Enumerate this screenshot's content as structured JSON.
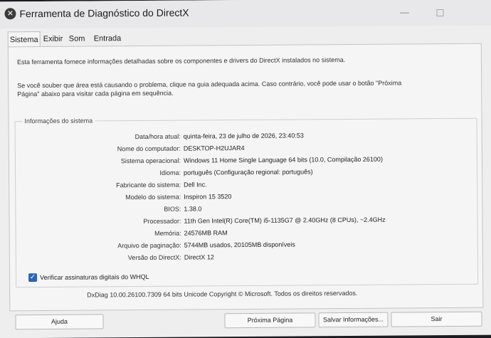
{
  "window": {
    "title": "Ferramenta de Diagnóstico do DirectX",
    "icon_glyph": "✕"
  },
  "tabs": [
    "Sistema",
    "Exibir",
    "Som",
    "Entrada"
  ],
  "intro_text": "Esta ferramenta fornece informações detalhadas sobre os componentes e drivers do DirectX instalados no sistema.",
  "hint_text": "Se você souber que área está causando o problema, clique na guia adequada acima. Caso contrário, você pode usar o botão \"Próxima Página\" abaixo para visitar cada página em sequência.",
  "system_info": {
    "group_title": "Informações do sistema",
    "rows": [
      {
        "label": "Data/hora atual:",
        "value": "quinta-feira, 23 de julho de 2026, 23:40:53"
      },
      {
        "label": "Nome do computador:",
        "value": "DESKTOP-H2UJAR4"
      },
      {
        "label": "Sistema operacional:",
        "value": "Windows 11 Home Single Language 64 bits (10.0, Compilação 26100)"
      },
      {
        "label": "Idioma:",
        "value": "português (Configuração regional: português)"
      },
      {
        "label": "Fabricante do sistema:",
        "value": "Dell Inc."
      },
      {
        "label": "Modelo do sistema:",
        "value": "Inspiron 15 3520"
      },
      {
        "label": "BIOS:",
        "value": "1.38.0"
      },
      {
        "label": "Processador:",
        "value": "11th Gen Intel(R) Core(TM) i5-1135G7 @ 2.40GHz (8 CPUs), ~2.4GHz"
      },
      {
        "label": "Memória:",
        "value": "24576MB RAM"
      },
      {
        "label": "Arquivo de paginação:",
        "value": "5744MB usados, 20105MB disponíveis"
      },
      {
        "label": "Versão do DirectX:",
        "value": "DirectX 12"
      }
    ]
  },
  "whql": {
    "label": "Verificar assinaturas digitais do WHQL",
    "checked": true,
    "check_glyph": "✓"
  },
  "footer_text": "DxDiag 10.00.26100.7309 64 bits Unicode  Copyright © Microsoft. Todos os direitos reservados.",
  "buttons": {
    "help": "Ajuda",
    "next": "Próxima Página",
    "save": "Salvar Informações...",
    "exit": "Sair"
  },
  "colors": {
    "accent": "#2a64b5"
  }
}
